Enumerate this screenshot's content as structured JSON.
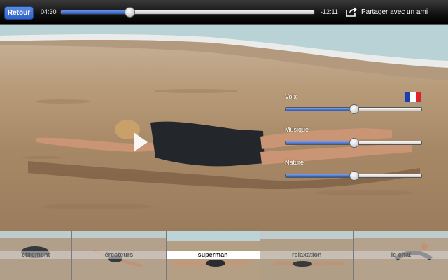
{
  "topbar": {
    "back_label": "Retour",
    "elapsed": "04:30",
    "remaining": "-12:11",
    "progress": 0.27,
    "share_label": "Partager avec un ami",
    "share_icon": "share-icon"
  },
  "video": {
    "play_icon": "play-icon",
    "flag_icon": "french-flag-icon",
    "controls": [
      {
        "label": "Voix",
        "value": 0.5
      },
      {
        "label": "Musique",
        "value": 0.5
      },
      {
        "label": "Nature",
        "value": 0.5
      }
    ]
  },
  "thumbnails": [
    {
      "label": "étirement",
      "selected": false
    },
    {
      "label": "érecteurs",
      "selected": false
    },
    {
      "label": "superman",
      "selected": true
    },
    {
      "label": "relaxation",
      "selected": false
    },
    {
      "label": "le chat",
      "selected": false
    }
  ],
  "colors": {
    "accent": "#2f62c7",
    "flag_blue": "#1f3fa8",
    "flag_white": "#ffffff",
    "flag_red": "#e02424"
  }
}
